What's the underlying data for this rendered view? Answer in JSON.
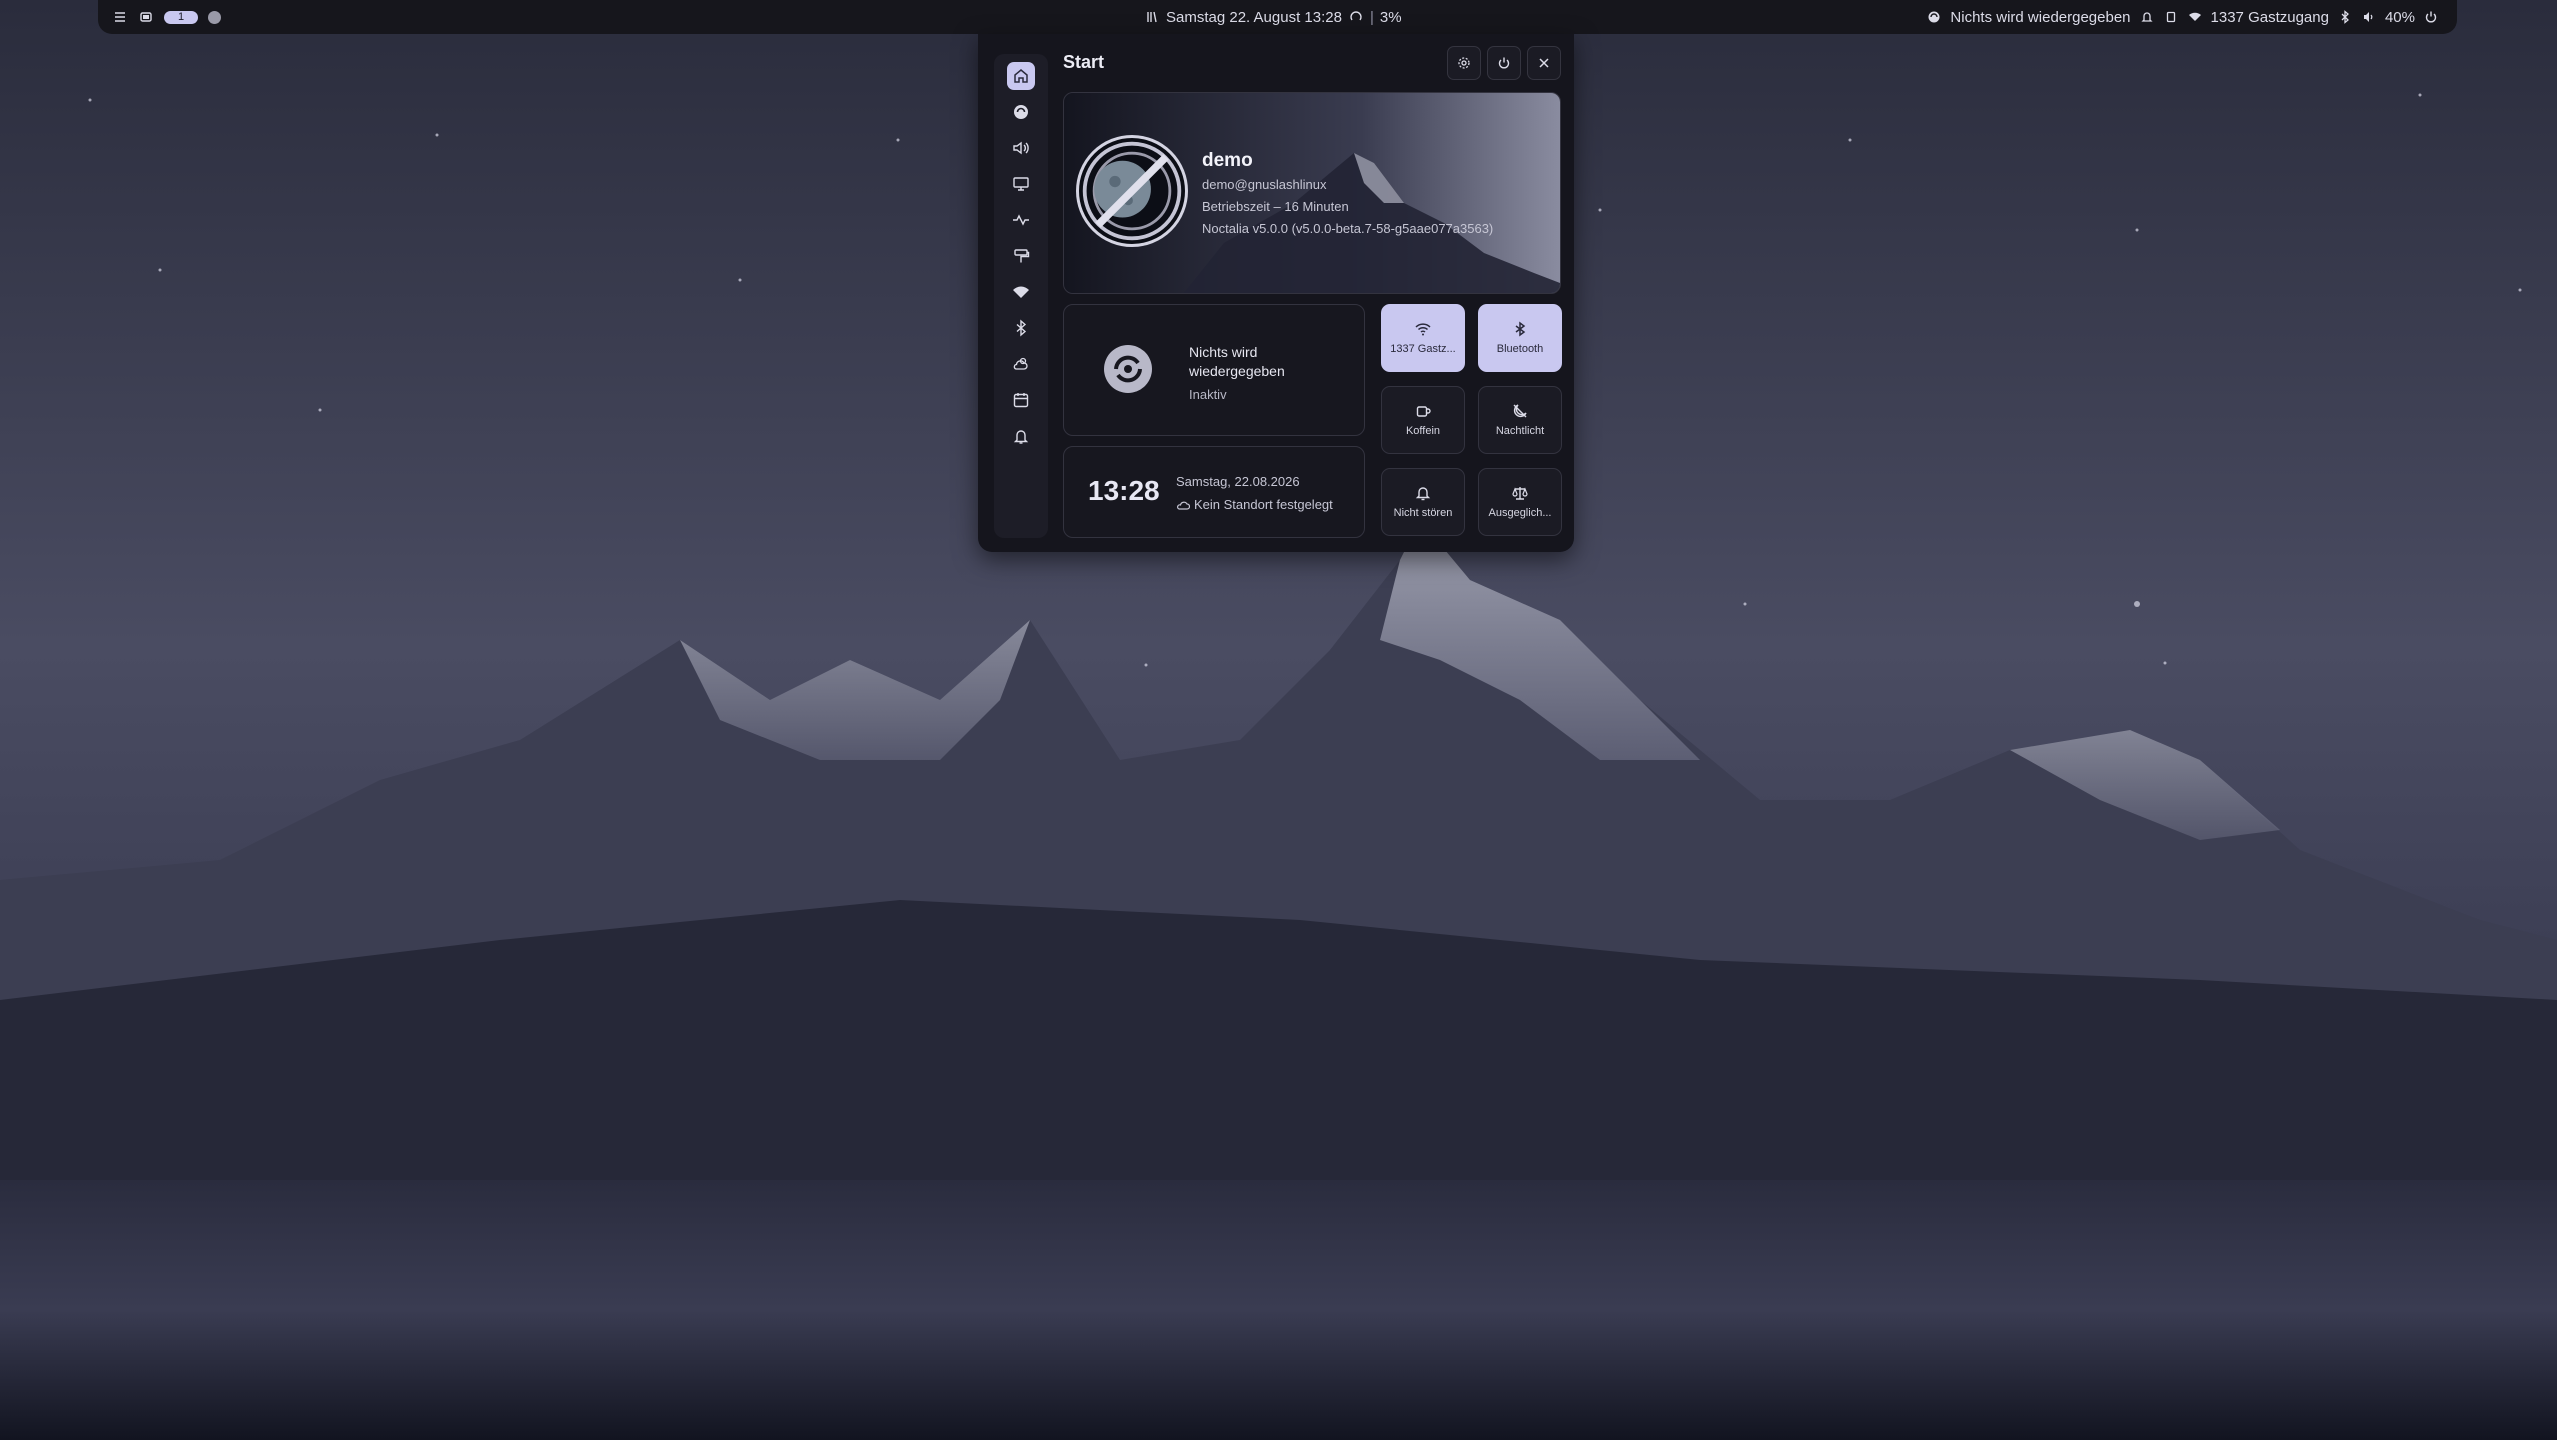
{
  "topbar": {
    "workspace_number": "1",
    "datetime": "Samstag 22. August 13:28",
    "cpu_separator": "|",
    "cpu_usage": "3%",
    "media_status": "Nichts wird wiedergegeben",
    "wifi_name": "1337 Gastzugang",
    "volume": "40%"
  },
  "panel": {
    "title": "Start",
    "nav_items": [
      "home",
      "media",
      "audio",
      "display",
      "system-monitor",
      "wallpaper",
      "wifi",
      "bluetooth",
      "weather",
      "calendar",
      "notifications"
    ],
    "profile": {
      "name": "demo",
      "user_host": "demo@gnuslashlinux",
      "uptime": "Betriebszeit – 16 Minuten",
      "version": "Noctalia v5.0.0 (v5.0.0-beta.7-58-g5aae077a3563)"
    },
    "media": {
      "title": "Nichts wird wiedergegeben",
      "status": "Inaktiv"
    },
    "clock": {
      "time": "13:28",
      "date": "Samstag, 22.08.2026",
      "weather": "Kein Standort festgelegt"
    },
    "tiles": {
      "wifi": "1337 Gastz...",
      "bluetooth": "Bluetooth",
      "caffeine": "Koffein",
      "nightlight": "Nachtlicht",
      "dnd": "Nicht stören",
      "power_profile": "Ausgeglich..."
    }
  },
  "colors": {
    "accent": "#c9c8f0",
    "panel_bg": "#15151d",
    "bar_bg": "#16161c"
  }
}
